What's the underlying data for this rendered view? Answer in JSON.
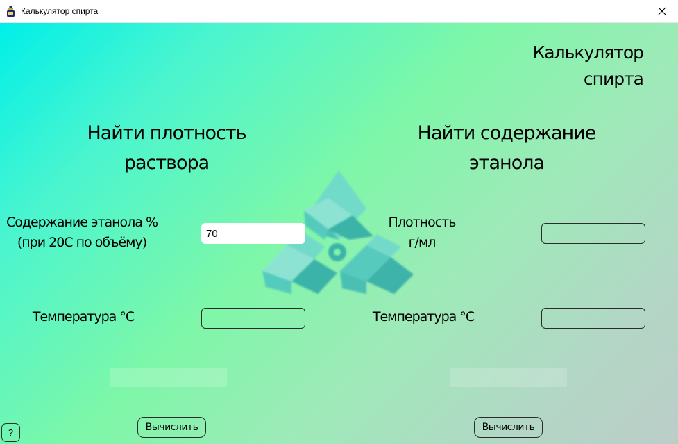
{
  "window": {
    "title": "Калькулятор спирта",
    "icon": "bottle-icon",
    "close_icon": "close-icon"
  },
  "header": {
    "line1": "Калькулятор",
    "line2": "спирта"
  },
  "density_section": {
    "title_line1": "Найти плотность",
    "title_line2": "раствора",
    "ethanol_label_line1": "Содержание этанола %",
    "ethanol_label_line2": "(при 20С по объёму)",
    "ethanol_value": "70",
    "temperature_label": "Температура °С",
    "temperature_value": "",
    "calculate_label": "Вычислить"
  },
  "ethanol_section": {
    "title_line1": "Найти содержание",
    "title_line2": "этанола",
    "density_label_line1": "Плотность",
    "density_label_line2": "г/мл",
    "density_value": "",
    "temperature_label": "Температура °С",
    "temperature_value": "",
    "calculate_label": "Вычислить"
  },
  "help": {
    "label": "?"
  },
  "colors": {
    "gradient_start": "#00efe9",
    "gradient_mid": "#7ef7a8",
    "gradient_end": "#bccdc8",
    "logo": "#3fb7b5"
  }
}
